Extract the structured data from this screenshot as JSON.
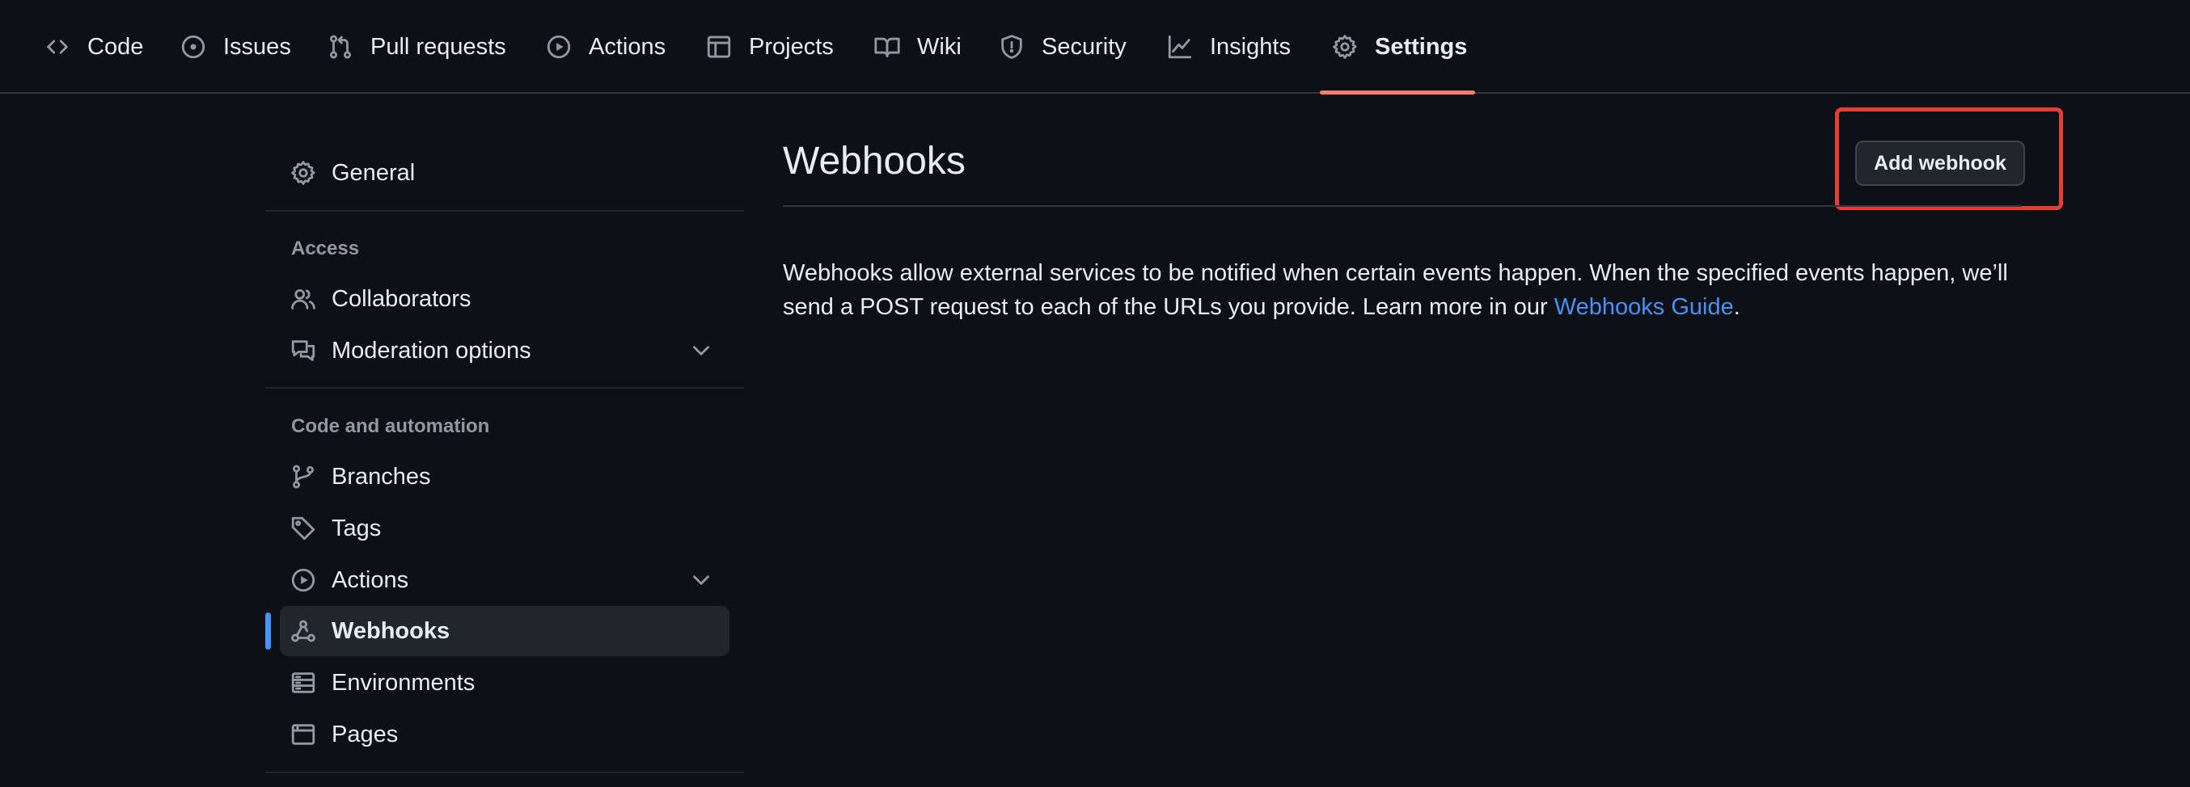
{
  "repo_nav": {
    "tabs": [
      {
        "label": "Code",
        "icon": "code-icon"
      },
      {
        "label": "Issues",
        "icon": "issue-opened-icon"
      },
      {
        "label": "Pull requests",
        "icon": "git-pull-request-icon"
      },
      {
        "label": "Actions",
        "icon": "play-icon"
      },
      {
        "label": "Projects",
        "icon": "table-icon"
      },
      {
        "label": "Wiki",
        "icon": "book-icon"
      },
      {
        "label": "Security",
        "icon": "shield-icon"
      },
      {
        "label": "Insights",
        "icon": "graph-icon"
      },
      {
        "label": "Settings",
        "icon": "gear-icon"
      }
    ],
    "active_tab": "Settings",
    "active_underline_color": "#f78166"
  },
  "sidebar": {
    "general": {
      "label": "General",
      "icon": "gear-icon"
    },
    "access_heading": "Access",
    "access_items": [
      {
        "label": "Collaborators",
        "icon": "people-icon"
      },
      {
        "label": "Moderation options",
        "icon": "comment-discussion-icon",
        "expandable": true
      }
    ],
    "code_heading": "Code and automation",
    "code_items": [
      {
        "label": "Branches",
        "icon": "git-branch-icon"
      },
      {
        "label": "Tags",
        "icon": "tag-icon"
      },
      {
        "label": "Actions",
        "icon": "play-icon",
        "expandable": true
      },
      {
        "label": "Webhooks",
        "icon": "webhook-icon",
        "active": true
      },
      {
        "label": "Environments",
        "icon": "server-icon"
      },
      {
        "label": "Pages",
        "icon": "browser-icon"
      }
    ],
    "active_indicator_color": "#4493f8"
  },
  "main": {
    "title": "Webhooks",
    "add_button_label": "Add webhook",
    "description_text": "Webhooks allow external services to be notified when certain events happen. When the specified events happen, we’ll send a POST request to each of the URLs you provide. Learn more in our ",
    "description_link": "Webhooks Guide",
    "description_end": ".",
    "link_color": "#4493f8"
  },
  "annotation": {
    "highlight_color": "#e5402f",
    "target": "add-webhook-button"
  }
}
